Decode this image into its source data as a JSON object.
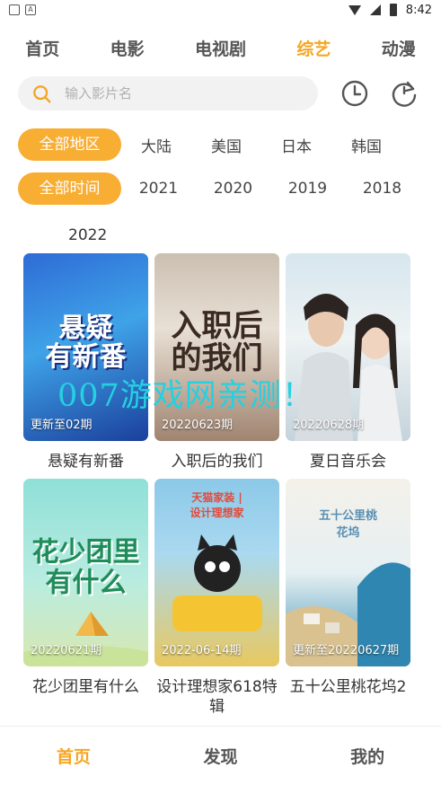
{
  "status_bar": {
    "time": "8:42",
    "notif_icon_letter": "A"
  },
  "top_nav": {
    "tabs": [
      {
        "label": "首页",
        "active": false
      },
      {
        "label": "电影",
        "active": false
      },
      {
        "label": "电视剧",
        "active": false
      },
      {
        "label": "综艺",
        "active": true
      },
      {
        "label": "动漫",
        "active": false
      }
    ]
  },
  "search": {
    "placeholder": "输入影片名",
    "value": ""
  },
  "icons": {
    "search": "search-icon",
    "history": "clock-icon",
    "refresh": "refresh-icon"
  },
  "filters": {
    "area": [
      "全部地区",
      "大陆",
      "美国",
      "日本",
      "韩国"
    ],
    "time": [
      "全部时间",
      "2021",
      "2020",
      "2019",
      "2018"
    ]
  },
  "section_label": "2022",
  "cards": [
    {
      "title": "悬疑有新番",
      "badge": "更新至02期",
      "art": "悬疑\n有新番"
    },
    {
      "title": "入职后的我们",
      "badge": "20220623期",
      "art": "入职后\n的我们"
    },
    {
      "title": "夏日音乐会",
      "badge": "20220628期",
      "art": ""
    },
    {
      "title": "花少团里有什么",
      "badge": "20220621期",
      "art": "花少团里\n有什么"
    },
    {
      "title": "设计理想家618特辑",
      "badge": "2022-06-14期",
      "art": "天猫家装 | 设计理想家"
    },
    {
      "title": "五十公里桃花坞2",
      "badge": "更新至20220627期",
      "art": "五十公里桃花坞"
    }
  ],
  "watermark": "007游戏网亲测！",
  "bottom_nav": {
    "tabs": [
      {
        "label": "首页",
        "active": true
      },
      {
        "label": "发现",
        "active": false
      },
      {
        "label": "我的",
        "active": false
      }
    ]
  },
  "colors": {
    "accent": "#f5a623",
    "chip_active": "#f8ad33",
    "watermark": "#25d0e0"
  }
}
